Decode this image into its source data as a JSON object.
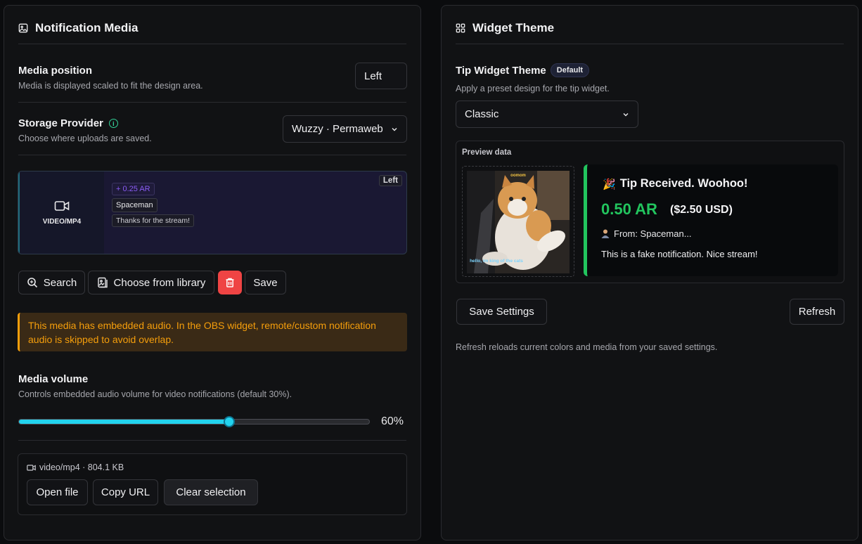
{
  "left_panel": {
    "title": "Notification Media",
    "media_position": {
      "label": "Media position",
      "description": "Media is displayed scaled to fit the design area.",
      "value": "Left"
    },
    "storage_provider": {
      "label": "Storage Provider",
      "description": "Choose where uploads are saved.",
      "value": "Wuzzy · Permaweb"
    },
    "preview": {
      "media_label": "VIDEO/MP4",
      "amount": "+ 0.25 AR",
      "name": "Spaceman",
      "message": "Thanks for the stream!",
      "position_badge": "Left"
    },
    "buttons": {
      "search": "Search",
      "choose_library": "Choose from library",
      "save": "Save"
    },
    "warning": "This media has embedded audio. In the OBS widget, remote/custom notification audio is skipped to avoid overlap.",
    "media_volume": {
      "label": "Media volume",
      "description": "Controls embedded audio volume for video notifications (default 30%).",
      "value_percent": 60,
      "value_text": "60%"
    },
    "file": {
      "info": "video/mp4 · 804.1 KB",
      "open_file": "Open file",
      "copy_url": "Copy URL",
      "clear_selection": "Clear selection"
    }
  },
  "right_panel": {
    "title": "Widget Theme",
    "theme": {
      "label": "Tip Widget Theme",
      "badge": "Default",
      "description": "Apply a preset design for the tip widget.",
      "selected": "Classic"
    },
    "preview_data": {
      "label": "Preview data",
      "gif_top_text": "oomom",
      "gif_bottom_text": "hello, im king of the cats",
      "tip_title": "Tip Received. Woohoo!",
      "tip_emoji": "🎉",
      "tip_amount": "0.50 AR",
      "tip_usd": "($2.50 USD)",
      "tip_from": "From: Spaceman...",
      "tip_message": "This is a fake notification. Nice stream!"
    },
    "save_settings": "Save Settings",
    "refresh": "Refresh",
    "refresh_note": "Refresh reloads current colors and media from your saved settings."
  },
  "colors": {
    "accent_cyan": "#22d3ee",
    "danger": "#ef4444",
    "warning": "#f59e0b",
    "success": "#22c55e"
  }
}
